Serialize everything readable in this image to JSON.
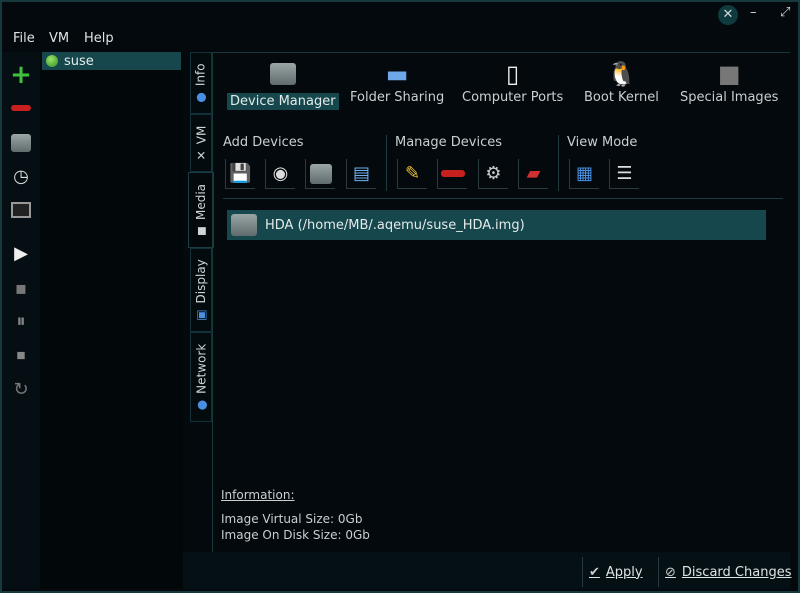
{
  "menu": [
    "File",
    "VM",
    "Help"
  ],
  "window_controls": {
    "close": "close-icon",
    "minimize": "minimize-icon",
    "maximize": "maximize-icon"
  },
  "toolbar": [
    "add-vm-icon",
    "remove-vm-icon",
    "hdd-icon",
    "clock-icon",
    "terminal-icon",
    "play-icon",
    "save-icon",
    "pause-icon",
    "stop-icon",
    "reset-icon"
  ],
  "vm_list": [
    {
      "name": "suse",
      "status_color": "#3fae2a"
    }
  ],
  "tabs": [
    "Info",
    "VM",
    "Media",
    "Display",
    "Network"
  ],
  "active_tab": "Media",
  "top_items": [
    "Device Manager",
    "Folder Sharing",
    "Computer Ports",
    "Boot Kernel",
    "Special Images"
  ],
  "sections": {
    "add": "Add Devices",
    "manage": "Manage Devices",
    "view": "View Mode"
  },
  "devices": [
    {
      "label": "HDA (/home/MB/.aqemu/suse_HDA.img)"
    }
  ],
  "information": {
    "title": "Information:",
    "virtual": "Image Virtual Size: 0Gb",
    "disk": "Image On Disk Size: 0Gb"
  },
  "buttons": {
    "apply": "Apply",
    "discard": "Discard Changes"
  },
  "accent": "#15474c"
}
